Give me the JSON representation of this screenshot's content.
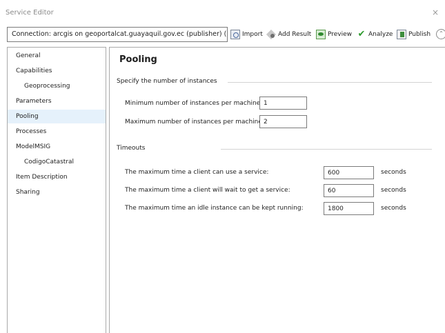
{
  "window": {
    "title": "Service Editor",
    "close_glyph": "×"
  },
  "toolbar": {
    "connection_label": "Connection: arcgis on geoportalcat.guayaquil.gov.ec (publisher) (...",
    "buttons": [
      {
        "label": "Import",
        "icon": "import-icon"
      },
      {
        "label": "Add Result",
        "icon": "add-result-icon"
      },
      {
        "label": "Preview",
        "icon": "preview-icon"
      },
      {
        "label": "Analyze",
        "icon": "check-icon"
      },
      {
        "label": "Publish",
        "icon": "publish-icon"
      }
    ],
    "collapse_glyph": "⌃"
  },
  "sidebar": {
    "items": [
      {
        "label": "General"
      },
      {
        "label": "Capabilities"
      },
      {
        "label": "Geoprocessing"
      },
      {
        "label": "Parameters"
      },
      {
        "label": "Pooling"
      },
      {
        "label": "Processes"
      },
      {
        "label": "ModelMSIG"
      },
      {
        "label": "CodigoCatastral"
      },
      {
        "label": "Item Description"
      },
      {
        "label": "Sharing"
      }
    ]
  },
  "main": {
    "title": "Pooling",
    "instances": {
      "heading": "Specify the number of instances",
      "min_label": "Minimum number of instances per machine:",
      "min_value": "1",
      "max_label": "Maximum number of instances per machine:",
      "max_value": "2"
    },
    "timeouts": {
      "heading": "Timeouts",
      "rows": [
        {
          "label": "The maximum time a client can use a service:",
          "value": "600",
          "unit": "seconds"
        },
        {
          "label": "The maximum time a client will wait to get a service:",
          "value": "60",
          "unit": "seconds"
        },
        {
          "label": "The maximum time an idle instance can be kept running:",
          "value": "1800",
          "unit": "seconds"
        }
      ]
    }
  }
}
